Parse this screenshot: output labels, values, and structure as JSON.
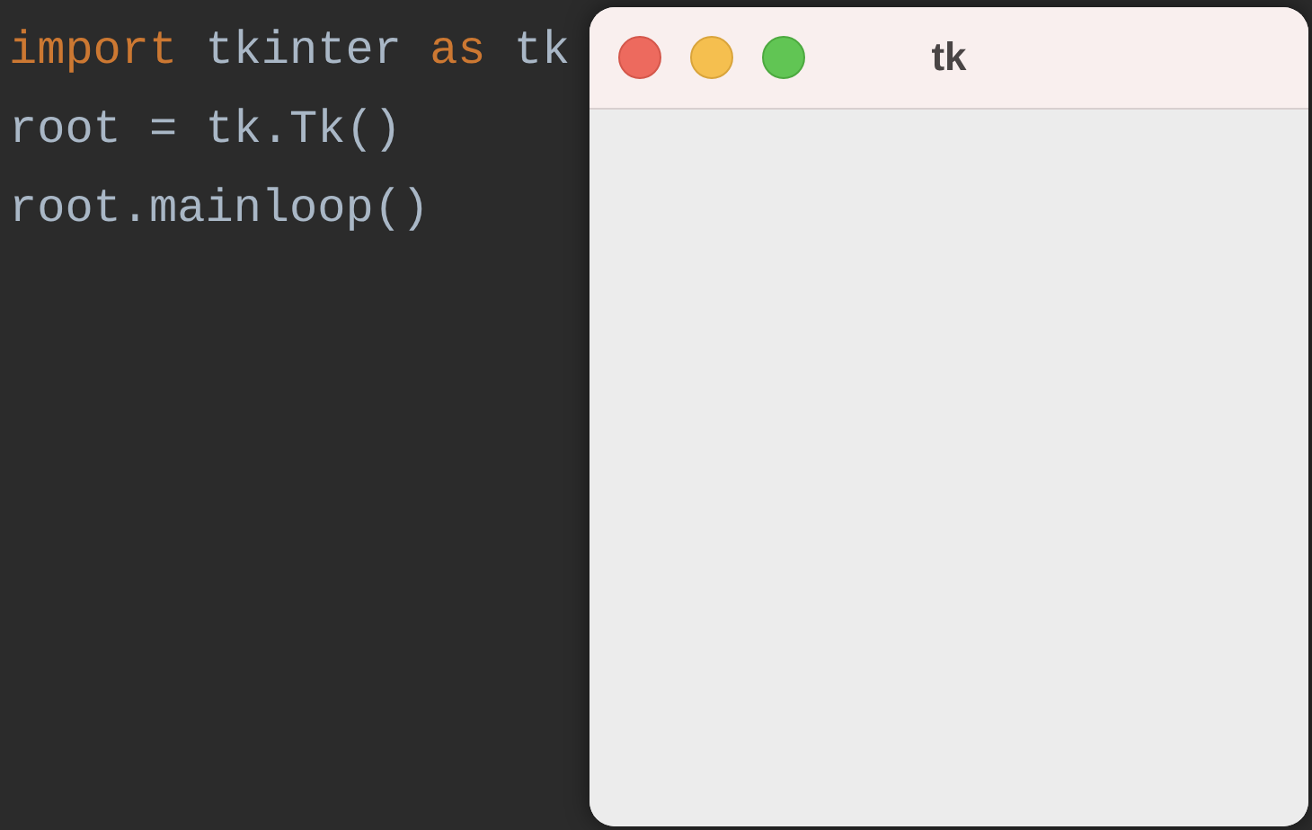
{
  "editor": {
    "lines": [
      {
        "tokens": [
          {
            "text": "import",
            "kind": "keyword"
          },
          {
            "text": " tkinter ",
            "kind": "plain"
          },
          {
            "text": "as",
            "kind": "keyword"
          },
          {
            "text": " tk",
            "kind": "plain"
          }
        ]
      },
      {
        "tokens": [
          {
            "text": "root = tk.Tk()",
            "kind": "plain"
          }
        ]
      },
      {
        "tokens": [
          {
            "text": "root.mainloop()",
            "kind": "plain"
          }
        ]
      }
    ]
  },
  "window": {
    "title": "tk"
  }
}
